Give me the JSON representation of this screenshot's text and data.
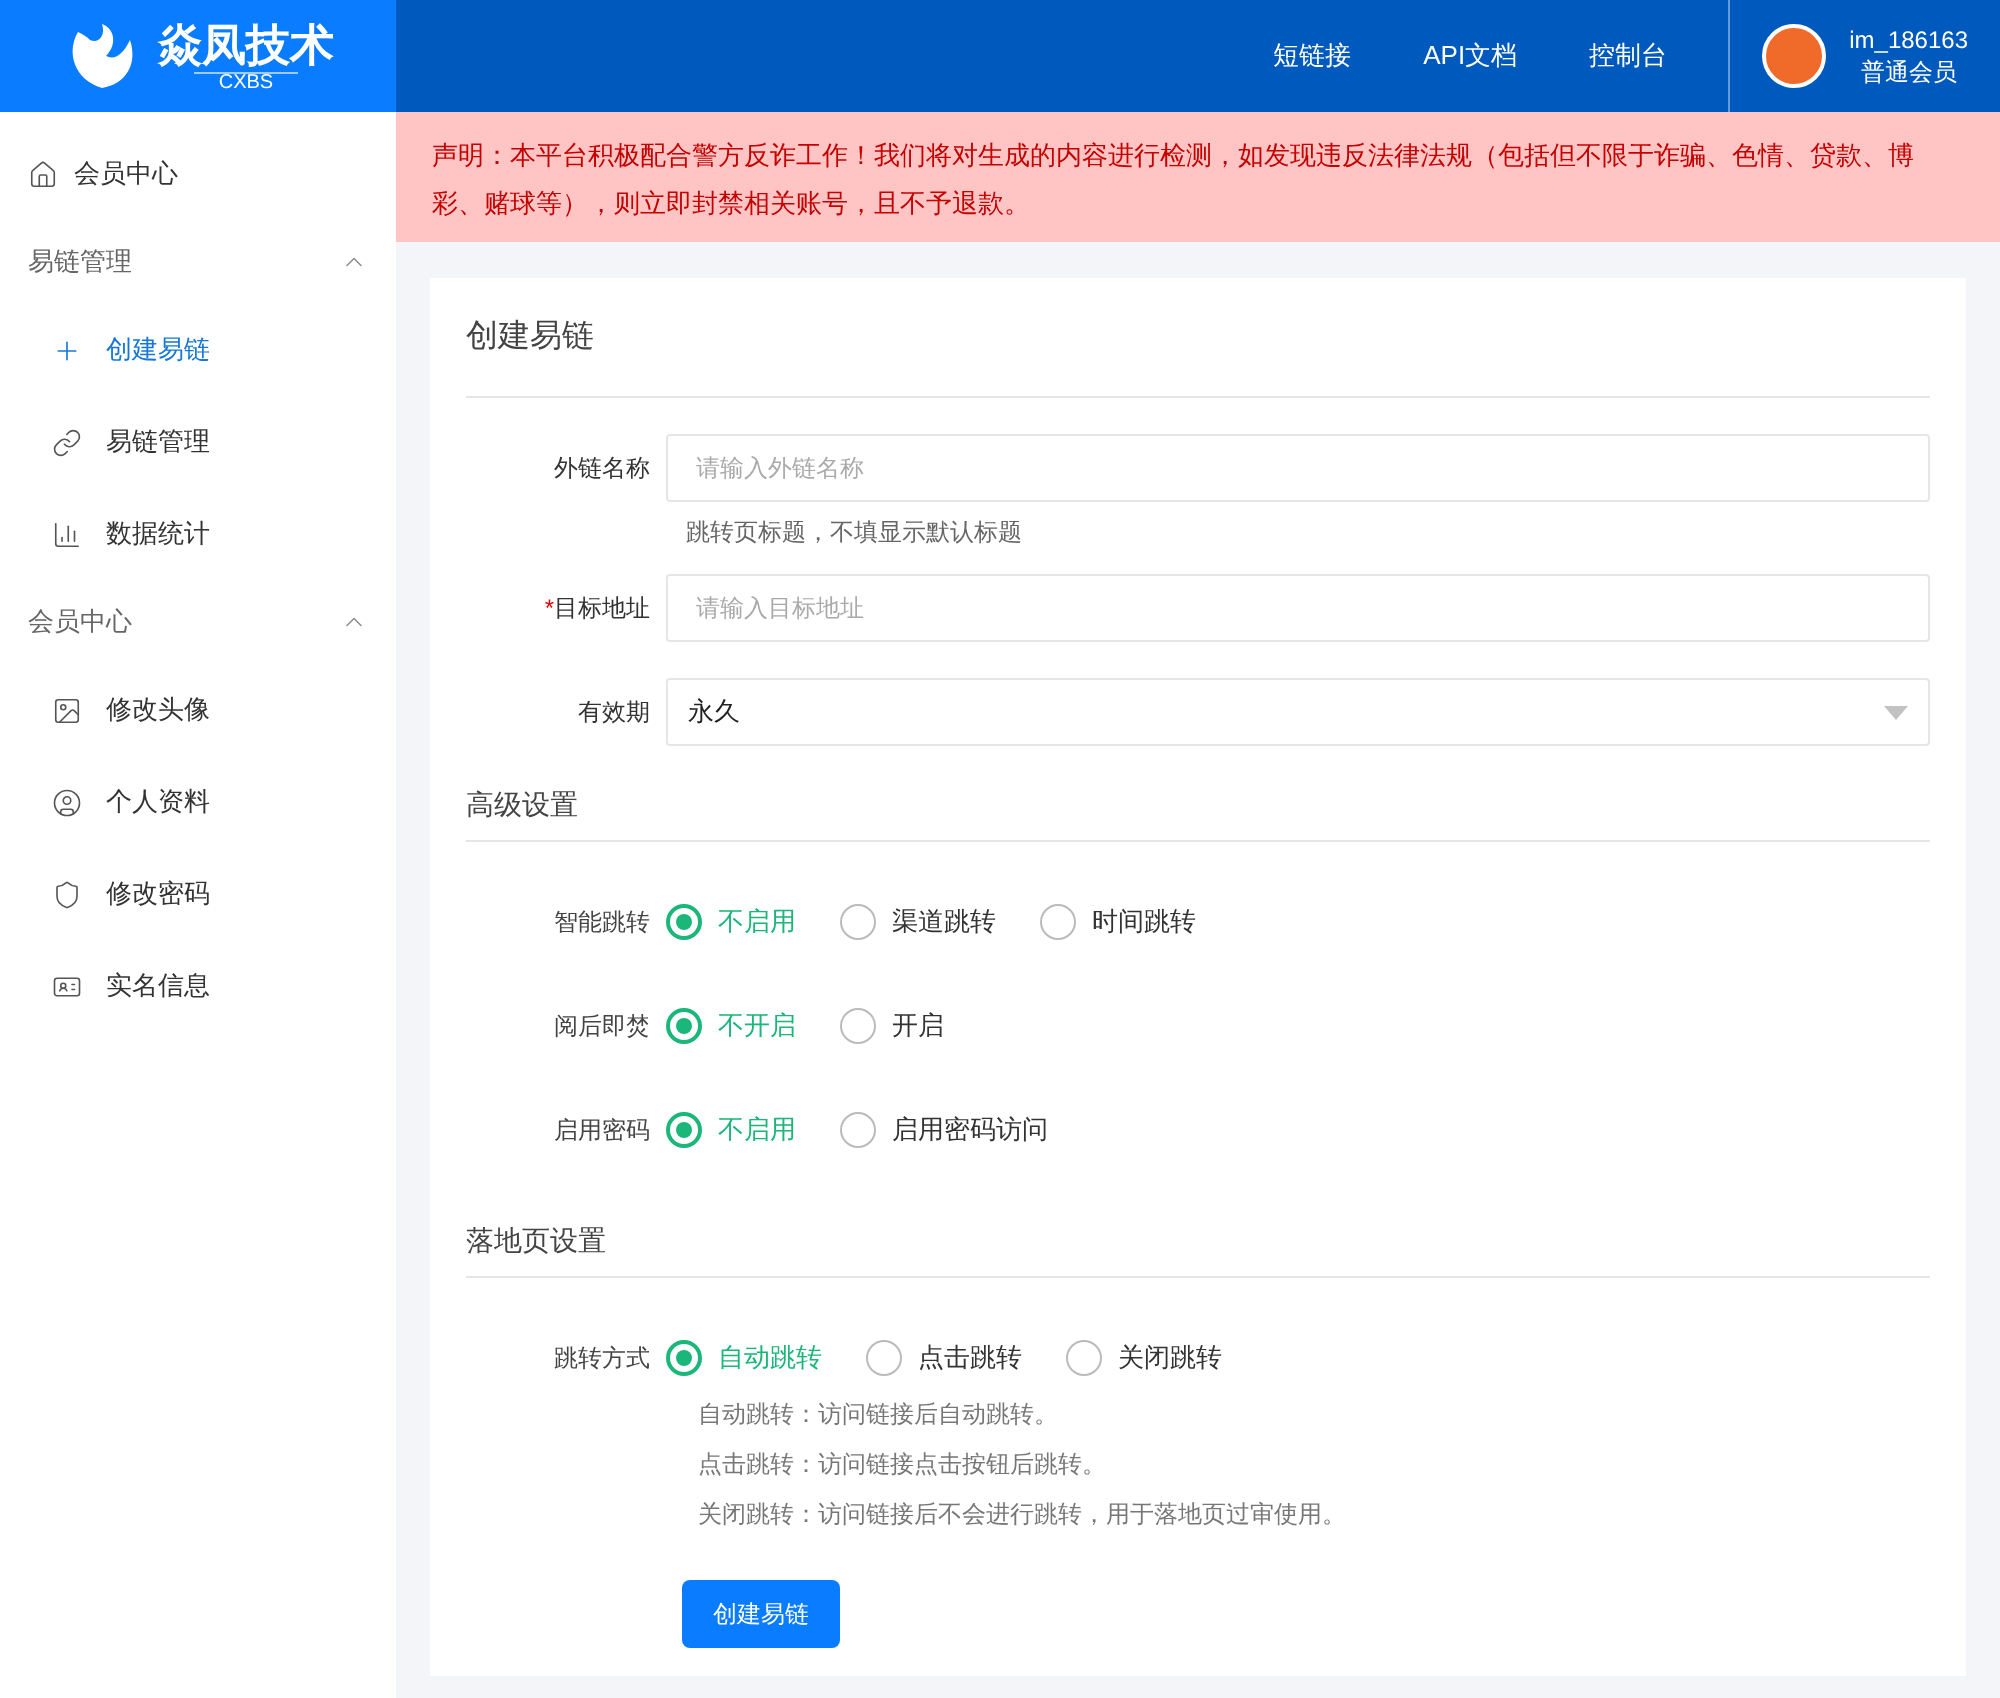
{
  "header": {
    "logo": {
      "title": "焱凤技术",
      "subtitle": "CXBS"
    },
    "nav": [
      {
        "label": "短链接"
      },
      {
        "label": "API文档"
      },
      {
        "label": "控制台"
      }
    ],
    "user": {
      "name": "im_186163",
      "role": "普通会员"
    }
  },
  "sidebar": {
    "items": [
      {
        "kind": "link",
        "label": "会员中心"
      },
      {
        "kind": "group",
        "label": "易链管理",
        "expanded": true,
        "children": [
          {
            "label": "创建易链",
            "selected": true
          },
          {
            "label": "易链管理",
            "selected": false
          },
          {
            "label": "数据统计",
            "selected": false
          }
        ]
      },
      {
        "kind": "group",
        "label": "会员中心",
        "expanded": true,
        "children": [
          {
            "label": "修改头像",
            "selected": false
          },
          {
            "label": "个人资料",
            "selected": false
          },
          {
            "label": "修改密码",
            "selected": false
          },
          {
            "label": "实名信息",
            "selected": false
          }
        ]
      }
    ]
  },
  "notice": "声明：本平台积极配合警方反诈工作！我们将对生成的内容进行检测，如发现违反法律法规（包括但不限于诈骗、色情、贷款、博彩、赌球等），则立即封禁相关账号，且不予退款。",
  "form": {
    "title": "创建易链",
    "fields": [
      {
        "kind": "input",
        "label": "外链名称",
        "placeholder": "请输入外链名称",
        "hint": "跳转页标题，不填显示默认标题"
      },
      {
        "kind": "input",
        "label": "目标地址",
        "required_mark": "*",
        "placeholder": "请输入目标地址"
      },
      {
        "kind": "select",
        "label": "有效期",
        "value": "永久"
      }
    ],
    "sections": [
      {
        "title": "高级设置",
        "groups": [
          {
            "label": "智能跳转",
            "options": [
              {
                "label": "不启用",
                "selected": true
              },
              {
                "label": "渠道跳转",
                "selected": false
              },
              {
                "label": "时间跳转",
                "selected": false
              }
            ]
          },
          {
            "label": "阅后即焚",
            "options": [
              {
                "label": "不开启",
                "selected": true
              },
              {
                "label": "开启",
                "selected": false
              }
            ]
          },
          {
            "label": "启用密码",
            "options": [
              {
                "label": "不启用",
                "selected": true
              },
              {
                "label": "启用密码访问",
                "selected": false
              }
            ]
          }
        ]
      },
      {
        "title": "落地页设置",
        "groups": [
          {
            "label": "跳转方式",
            "options": [
              {
                "label": "自动跳转",
                "selected": true
              },
              {
                "label": "点击跳转",
                "selected": false
              },
              {
                "label": "关闭跳转",
                "selected": false
              }
            ],
            "notes": [
              "自动跳转：访问链接后自动跳转。",
              "点击跳转：访问链接点击按钮后跳转。",
              "关闭跳转：访问链接后不会进行跳转，用于落地页过审使用。"
            ]
          }
        ]
      }
    ],
    "submit": "创建易链"
  }
}
